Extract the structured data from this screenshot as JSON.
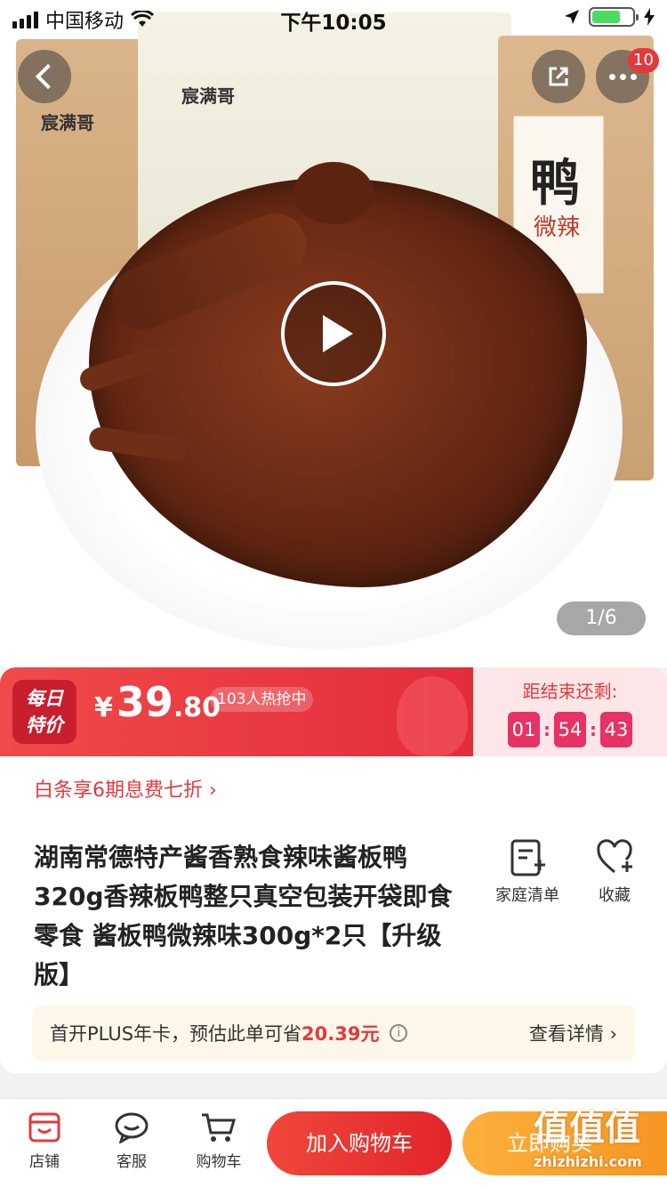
{
  "status_bar": {
    "carrier": "中国移动",
    "time": "下午10:05"
  },
  "hero": {
    "pager": "1/6",
    "more_badge": "10",
    "brand_text": "宸满哥",
    "pack_text_1": "鸭",
    "pack_text_2": "微辣"
  },
  "flash_sale": {
    "tag_line1": "每日",
    "tag_line2": "特价",
    "currency": "¥",
    "price_int": "39",
    "price_dec": ".80",
    "hot_text": "103人热抢中",
    "countdown_label": "距结束还剩:",
    "hours": "01",
    "minutes": "54",
    "seconds": "43"
  },
  "info": {
    "promo": "白条享6期息费七折 ›",
    "title": "湖南常德特产酱香熟食辣味酱板鸭320g香辣板鸭整只真空包装开袋即食零食 酱板鸭微辣味300g*2只【升级版】",
    "family_list_label": "家庭清单",
    "favorite_label": "收藏",
    "plus_text": "首开PLUS年卡，预估此单可省",
    "plus_save": "20.39元",
    "plus_detail": "查看详情 ›"
  },
  "bottom_bar": {
    "store": "店铺",
    "service": "客服",
    "cart": "购物车",
    "add_to_cart": "加入购物车",
    "buy_now": "立即购买"
  },
  "watermark": {
    "line1": "值值值",
    "line2": "zhizhizhi.com"
  },
  "colors": {
    "accent_red": "#e4393c",
    "countdown_pink": "#e63264",
    "buy_orange": "#f79523"
  }
}
